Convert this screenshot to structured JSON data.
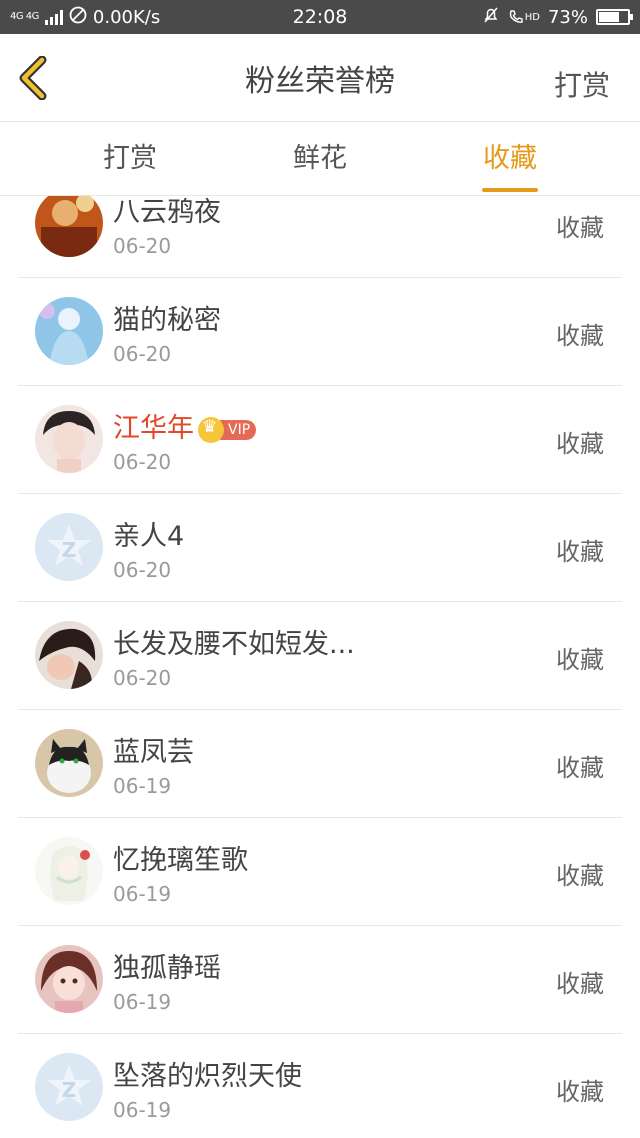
{
  "status_bar": {
    "network": "4G 4G",
    "speed": "0.00K/s",
    "time": "22:08",
    "hd": "HD",
    "battery": "73%",
    "battery_level": 0.73
  },
  "header": {
    "title": "粉丝荣誉榜",
    "action": "打赏"
  },
  "tabs": [
    {
      "label": "打赏",
      "active": false
    },
    {
      "label": "鲜花",
      "active": false
    },
    {
      "label": "收藏",
      "active": true
    }
  ],
  "list": [
    {
      "name": "八云鸦夜",
      "date": "06-20",
      "action": "收藏"
    },
    {
      "name": "猫的秘密",
      "date": "06-20",
      "action": "收藏"
    },
    {
      "name": "江华年",
      "date": "06-20",
      "action": "收藏",
      "vip_label": "VIP"
    },
    {
      "name": "亲人4",
      "date": "06-20",
      "action": "收藏"
    },
    {
      "name": "长发及腰不如短发...",
      "date": "06-20",
      "action": "收藏"
    },
    {
      "name": "蓝凤芸",
      "date": "06-19",
      "action": "收藏"
    },
    {
      "name": "忆挽璃笙歌",
      "date": "06-19",
      "action": "收藏"
    },
    {
      "name": "独孤静瑶",
      "date": "06-19",
      "action": "收藏"
    },
    {
      "name": "坠落的炽烈天使",
      "date": "06-19",
      "action": "收藏"
    }
  ],
  "colors": {
    "accent": "#e69a1a",
    "vip_name": "#e04a2a",
    "status_bar": "#4a4a4a"
  }
}
